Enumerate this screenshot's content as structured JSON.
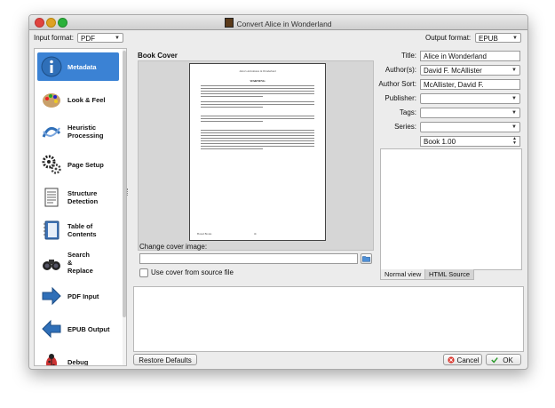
{
  "window": {
    "title": "Convert Alice in Wonderland"
  },
  "header": {
    "input_format_label": "Input format:",
    "input_format_value": "PDF",
    "output_format_label": "Output format:",
    "output_format_value": "EPUB"
  },
  "sidebar": {
    "items": [
      {
        "label": "Metadata",
        "icon": "info-icon"
      },
      {
        "label": "Look & Feel",
        "icon": "paint-palette-icon"
      },
      {
        "label": "Heuristic\nProcessing",
        "icon": "heuristics-icon"
      },
      {
        "label": "Page Setup",
        "icon": "gears-icon"
      },
      {
        "label": "Structure\nDetection",
        "icon": "document-icon"
      },
      {
        "label": "Table of\nContents",
        "icon": "notebook-icon"
      },
      {
        "label": "Search\n&\nReplace",
        "icon": "binoculars-icon"
      },
      {
        "label": "PDF Input",
        "icon": "arrow-right-icon"
      },
      {
        "label": "EPUB Output",
        "icon": "arrow-left-icon"
      },
      {
        "label": "Debug",
        "icon": "bug-icon"
      }
    ]
  },
  "cover": {
    "title": "Book Cover",
    "change_label": "Change cover image:",
    "use_source_label": "Use cover from source file",
    "page_header": "Alice's Adventures in Wonderland",
    "page_heading": "WARNING",
    "page_footer_left": "Boxed Books",
    "page_footer_right": "iii"
  },
  "metadata": {
    "title_label": "Title:",
    "title_value": "Alice in Wonderland",
    "authors_label": "Author(s):",
    "authors_value": "David F. McAllister",
    "author_sort_label": "Author Sort:",
    "author_sort_value": "McAllister, David F.",
    "publisher_label": "Publisher:",
    "publisher_value": "",
    "tags_label": "Tags:",
    "tags_value": "",
    "series_label": "Series:",
    "series_value": "",
    "series_index": "Book 1.00"
  },
  "comments": {
    "tab_normal": "Normal view",
    "tab_html": "HTML Source"
  },
  "footer": {
    "restore": "Restore Defaults",
    "cancel": "Cancel",
    "ok": "OK"
  },
  "colors": {
    "selection": "#3b82d4",
    "window_bg": "#ececec"
  }
}
